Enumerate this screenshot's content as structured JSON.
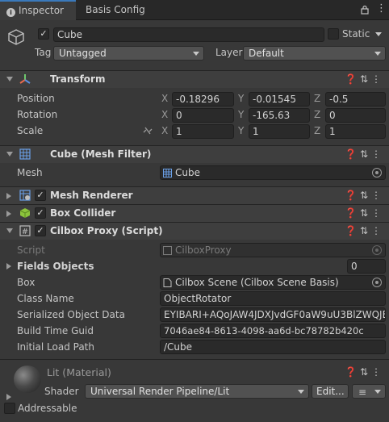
{
  "tabs": {
    "inspector": "Inspector",
    "basis_config": "Basis Config"
  },
  "gameobject": {
    "name": "Cube",
    "static_label": "Static",
    "tag_label": "Tag",
    "tag_value": "Untagged",
    "layer_label": "Layer",
    "layer_value": "Default"
  },
  "transform": {
    "title": "Transform",
    "position_label": "Position",
    "rotation_label": "Rotation",
    "scale_label": "Scale",
    "axis_x": "X",
    "axis_y": "Y",
    "axis_z": "Z",
    "position": {
      "x": "-0.18296",
      "y": "-0.01545",
      "z": "-0.5"
    },
    "rotation": {
      "x": "0",
      "y": "-165.63",
      "z": "0"
    },
    "scale": {
      "x": "1",
      "y": "1",
      "z": "1"
    }
  },
  "mesh_filter": {
    "title": "Cube (Mesh Filter)",
    "mesh_label": "Mesh",
    "mesh_value": "Cube"
  },
  "mesh_renderer": {
    "title": "Mesh Renderer"
  },
  "box_collider": {
    "title": "Box Collider"
  },
  "proxy": {
    "title": "Cilbox Proxy (Script)",
    "script_label": "Script",
    "script_value": "CilboxProxy",
    "fields_label": "Fields Objects",
    "fields_count": "0",
    "box_label": "Box",
    "box_value": "Cilbox Scene (Cilbox Scene Basis)",
    "class_label": "Class Name",
    "class_value": "ObjectRotator",
    "serialized_label": "Serialized Object Data",
    "serialized_value": "EYIBARI+AQoJAW4JDXJvdGF0aW9uU3BlZWQJB",
    "guid_label": "Build Time Guid",
    "guid_value": "7046ae84-8613-4098-aa6d-bc78782b420c",
    "path_label": "Initial Load Path",
    "path_value": "/Cube"
  },
  "material": {
    "name": "Lit (Material)",
    "shader_label": "Shader",
    "shader_value": "Universal Render Pipeline/Lit",
    "edit_label": "Edit..."
  },
  "footer": {
    "addressable_label": "Addressable"
  },
  "colors": {
    "accent": "#3a79bb",
    "background": "#383838",
    "header": "#3e3e3e",
    "field": "#2a2a2a"
  }
}
